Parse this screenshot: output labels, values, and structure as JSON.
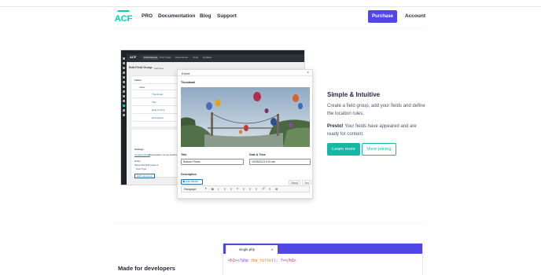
{
  "nav": {
    "logo": "ACF",
    "links": [
      "PRO",
      "Documentation",
      "Blog",
      "Support"
    ],
    "purchase": "Purchase",
    "account": "Account"
  },
  "admin": {
    "page_title": "Edit Field Group",
    "subtitle": "Add New",
    "tabs": [
      "Field Groups",
      "Post Types",
      "Taxonomies",
      "Tools",
      "Updates"
    ],
    "fields_title": "Fields",
    "column_label": "Label",
    "rows": [
      "Thumbnail",
      "Title",
      "Date & Time",
      "Description"
    ],
    "settings_title": "Settings",
    "settings_tabs": [
      "Location Rules",
      "Presentation",
      "Group Settings"
    ],
    "rules_label": "Rules",
    "rule_line": "Show this field group if",
    "rule_value": "Post Type",
    "add_rule": "Add rule group"
  },
  "modal": {
    "title": "Event",
    "close": "×",
    "thumbnail_label": "Thumbnail",
    "title_label": "Title",
    "title_value": "Balloon Fiesta",
    "date_label": "Date & Time",
    "date_value": "15/08/2023 9:00 am",
    "description_label": "Description",
    "add_media": "Add Media",
    "visual_tab": "Visual",
    "text_tab": "Text",
    "paragraph": "Paragraph",
    "toolbar": [
      "B",
      "I",
      "≡",
      "≡",
      "❝",
      "≡",
      "≡",
      "≡",
      "🔗",
      "≡",
      "⊞"
    ]
  },
  "feature": {
    "heading": "Simple & Intuitive",
    "text1": "Create a field group, add your fields and define the location rules.",
    "presto": "Presto!",
    "text2": "Your fields have appeared and are ready for content.",
    "learn_more": "Learn more",
    "view_pricing": "View pricing"
  },
  "code": {
    "filename": "single.php",
    "caret": "▾",
    "line_open": "<h1>",
    "line_php": "<?php ",
    "line_fn": "the_title",
    "line_rest": "(); ?>",
    "line_close": "</h1>"
  },
  "developers": {
    "heading": "Made for developers"
  },
  "colors": {
    "accent": "#4f46e5",
    "teal": "#14b8a6",
    "wp_dark": "#1d2327"
  }
}
